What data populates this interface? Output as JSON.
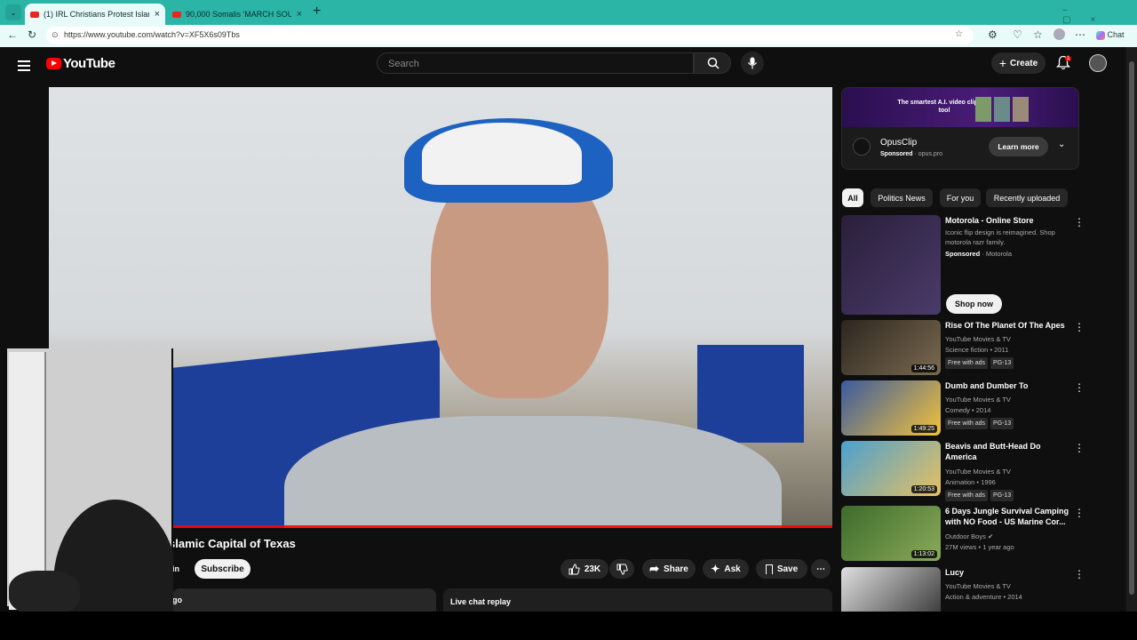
{
  "browser": {
    "tabs": [
      {
        "title": "(1) IRL Christians Protest Islamic C",
        "active": true
      },
      {
        "title": "90,000 Somalis 'MARCH SOUTH'",
        "active": false
      }
    ],
    "url": "https://www.youtube.com/watch?v=XF5X6s09Tbs",
    "chat_label": "Chat"
  },
  "youtube": {
    "logo_text": "YouTube",
    "search_placeholder": "Search",
    "create_label": "Create",
    "notification_count": "1"
  },
  "video": {
    "title": "slamic Capital of Texas",
    "join_label": "in",
    "subscribe_label": "Subscribe",
    "like_count": "23K",
    "share_label": "Share",
    "ask_label": "Ask",
    "save_label": "Save",
    "description_snippet": "go",
    "live_chat_label": "Live chat replay"
  },
  "ad": {
    "banner_text": "The smartest A.I. video clipping tool",
    "brand": "OpusClip",
    "sponsored_label": "Sponsored",
    "domain": "opus.pro",
    "cta": "Learn more"
  },
  "chips": [
    "All",
    "Politics News",
    "For you",
    "Recently uploaded"
  ],
  "recommendations": [
    {
      "title": "Motorola - Online Store",
      "desc": "Iconic flip design is reimagined. Shop motorola razr family.",
      "sponsored": "Sponsored",
      "channel": "Motorola",
      "cta": "Shop now"
    },
    {
      "title": "Rise Of The Planet Of The Apes",
      "channel": "YouTube Movies & TV",
      "meta": "Science fiction • 2011",
      "tag1": "Free with ads",
      "tag2": "PG-13",
      "duration": "1:44:56"
    },
    {
      "title": "Dumb and Dumber To",
      "channel": "YouTube Movies & TV",
      "meta": "Comedy • 2014",
      "tag1": "Free with ads",
      "tag2": "PG-13",
      "duration": "1:49:25"
    },
    {
      "title": "Beavis and Butt-Head Do America",
      "channel": "YouTube Movies & TV",
      "meta": "Animation • 1996",
      "tag1": "Free with ads",
      "tag2": "PG-13",
      "duration": "1:20:53"
    },
    {
      "title": "6 Days Jungle Survival Camping with NO Food - US Marine Cor...",
      "channel": "Outdoor Boys",
      "meta": "27M views • 1 year ago",
      "duration": "1:13:02"
    },
    {
      "title": "Lucy",
      "channel": "YouTube Movies & TV",
      "meta": "Action & adventure • 2014"
    }
  ],
  "colors": {
    "brand_red": "#ff0000",
    "browser_teal": "#2bb5a7",
    "bg": "#0f0f0f"
  }
}
